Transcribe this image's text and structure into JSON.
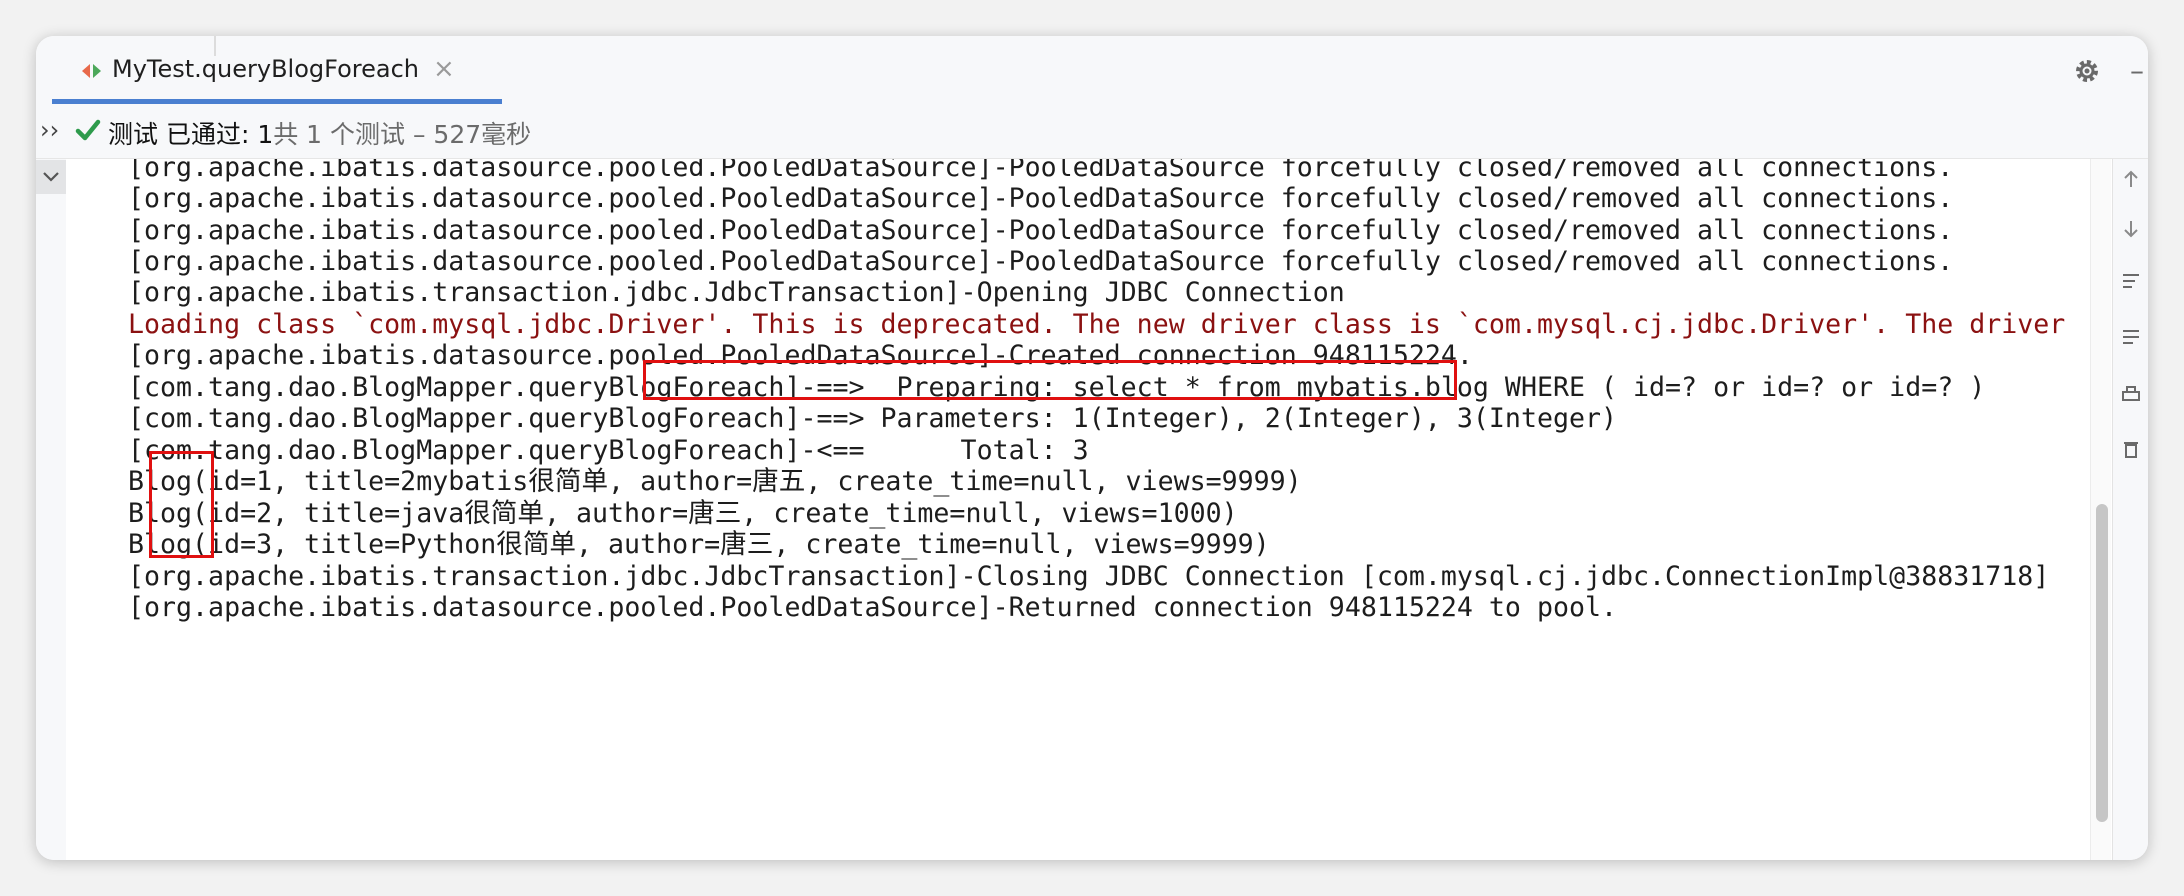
{
  "tab": {
    "title": "MyTest.queryBlogForeach",
    "close": "×"
  },
  "status": {
    "expand": "››",
    "label": "测试 已通过: 1",
    "detail": "共 1 个测试 – 527毫秒"
  },
  "console": {
    "lines": [
      "[org.apache.ibatis.datasource.pooled.PooledDataSource]-PooledDataSource forcefully closed/removed all connections.",
      "[org.apache.ibatis.datasource.pooled.PooledDataSource]-PooledDataSource forcefully closed/removed all connections.",
      "[org.apache.ibatis.datasource.pooled.PooledDataSource]-PooledDataSource forcefully closed/removed all connections.",
      "[org.apache.ibatis.datasource.pooled.PooledDataSource]-PooledDataSource forcefully closed/removed all connections.",
      "[org.apache.ibatis.transaction.jdbc.JdbcTransaction]-Opening JDBC Connection",
      "Loading class `com.mysql.jdbc.Driver'. This is deprecated. The new driver class is `com.mysql.cj.jdbc.Driver'. The driver is",
      "[org.apache.ibatis.datasource.pooled.PooledDataSource]-Created connection 948115224.",
      "[com.tang.dao.BlogMapper.queryBlogForeach]-==>  Preparing: select * from mybatis.blog WHERE ( id=? or id=? or id=? )",
      "[com.tang.dao.BlogMapper.queryBlogForeach]-==> Parameters: 1(Integer), 2(Integer), 3(Integer)",
      "[com.tang.dao.BlogMapper.queryBlogForeach]-<==      Total: 3",
      "Blog(id=1, title=2mybatis很简单, author=唐五, create_time=null, views=9999)",
      "Blog(id=2, title=java很简单, author=唐三, create_time=null, views=1000)",
      "Blog(id=3, title=Python很简单, author=唐三, create_time=null, views=9999)",
      "[org.apache.ibatis.transaction.jdbc.JdbcTransaction]-Closing JDBC Connection [com.mysql.cj.jdbc.ConnectionImpl@38831718]",
      "[org.apache.ibatis.datasource.pooled.PooledDataSource]-Returned connection 948115224 to pool."
    ]
  },
  "colors": {
    "warning_text": "#8b1111",
    "highlight_box": "#e01010",
    "pass_check": "#2e9b4c",
    "tab_accent": "#4a7fd0"
  },
  "icons": [
    "run-config-icon",
    "close-icon",
    "gear-icon",
    "minimize-icon",
    "expand-icon",
    "check-icon",
    "collapse-chevron-icon",
    "scroll-up-icon",
    "scroll-down-icon",
    "soft-wrap-icon",
    "filter-icon",
    "print-icon",
    "trash-icon"
  ]
}
